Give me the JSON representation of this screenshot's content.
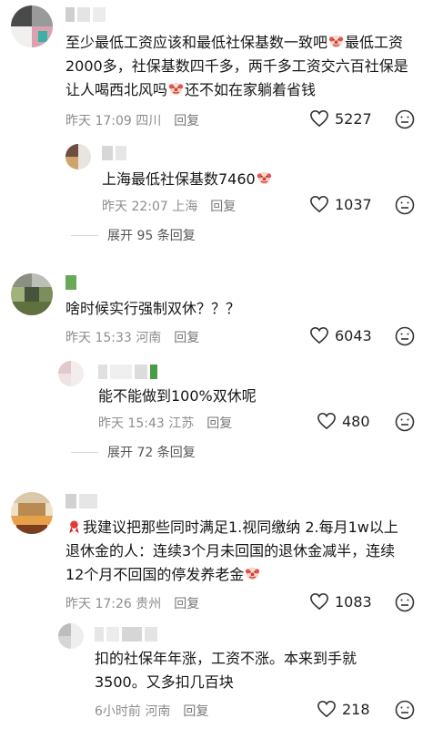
{
  "comments": [
    {
      "text": "至少最低工资应该和最低社保基数一致吧",
      "text_mid": "最低工资2000多，社保基数四千多，两千多工资交六百社保是让人喝西北风吗",
      "text_end": "还不如在家躺着省钱",
      "time": "昨天 17:09 四川",
      "reply": "回复",
      "likes": "5227",
      "reply_item": {
        "text": "上海最低社保基数7460",
        "time": "昨天 22:07 上海",
        "reply": "回复",
        "likes": "1037"
      },
      "expand": "展开 95 条回复"
    },
    {
      "text": "啥时候实行强制双休？？？",
      "time": "昨天 15:33 河南",
      "reply": "回复",
      "likes": "6043",
      "reply_item": {
        "text": "能不能做到100%双休呢",
        "time": "昨天 15:43 江苏",
        "reply": "回复",
        "likes": "480"
      },
      "expand": "展开 72 条回复"
    },
    {
      "text_line1": "我建议把那些同时满足1.视同缴纳 2.每月1w以上",
      "text_line2": "退休金的人：连续3个月未回国的退休金减半，连续",
      "text_line3": "12个月不回国的停发养老金",
      "time": "昨天 17:26 贵州",
      "reply": "回复",
      "likes": "1083",
      "reply_item": {
        "text_line1": "扣的社保年年涨，工资不涨。本来到手就",
        "text_line2": "3500。又多扣几百块",
        "time": "6小时前 河南",
        "reply": "回复",
        "likes": "218"
      }
    }
  ],
  "icons": {
    "like": "heart-outline-icon",
    "dislike": "meh-face-icon",
    "emoji": "clown-emoji"
  }
}
